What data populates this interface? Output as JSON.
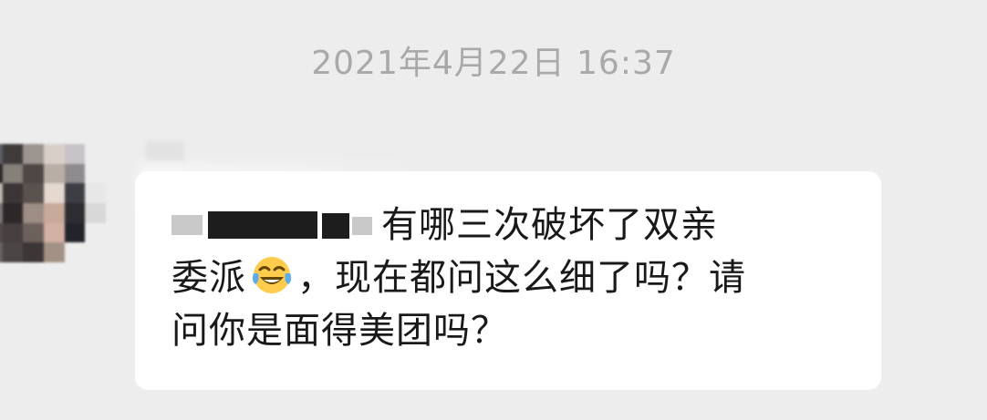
{
  "timestamp": "2021年4月22日 16:37",
  "message": {
    "line1": "有哪三次破坏了双亲",
    "line2_before_emoji": "委派",
    "emoji": "tears-of-joy-emoji",
    "line2_after_emoji": "，现在都问这么细了吗？请",
    "line3": "问你是面得美团吗？"
  },
  "colors": {
    "background": "#ededed",
    "bubble": "#ffffff",
    "timestamp": "#a9a9a9",
    "text": "#191919"
  }
}
